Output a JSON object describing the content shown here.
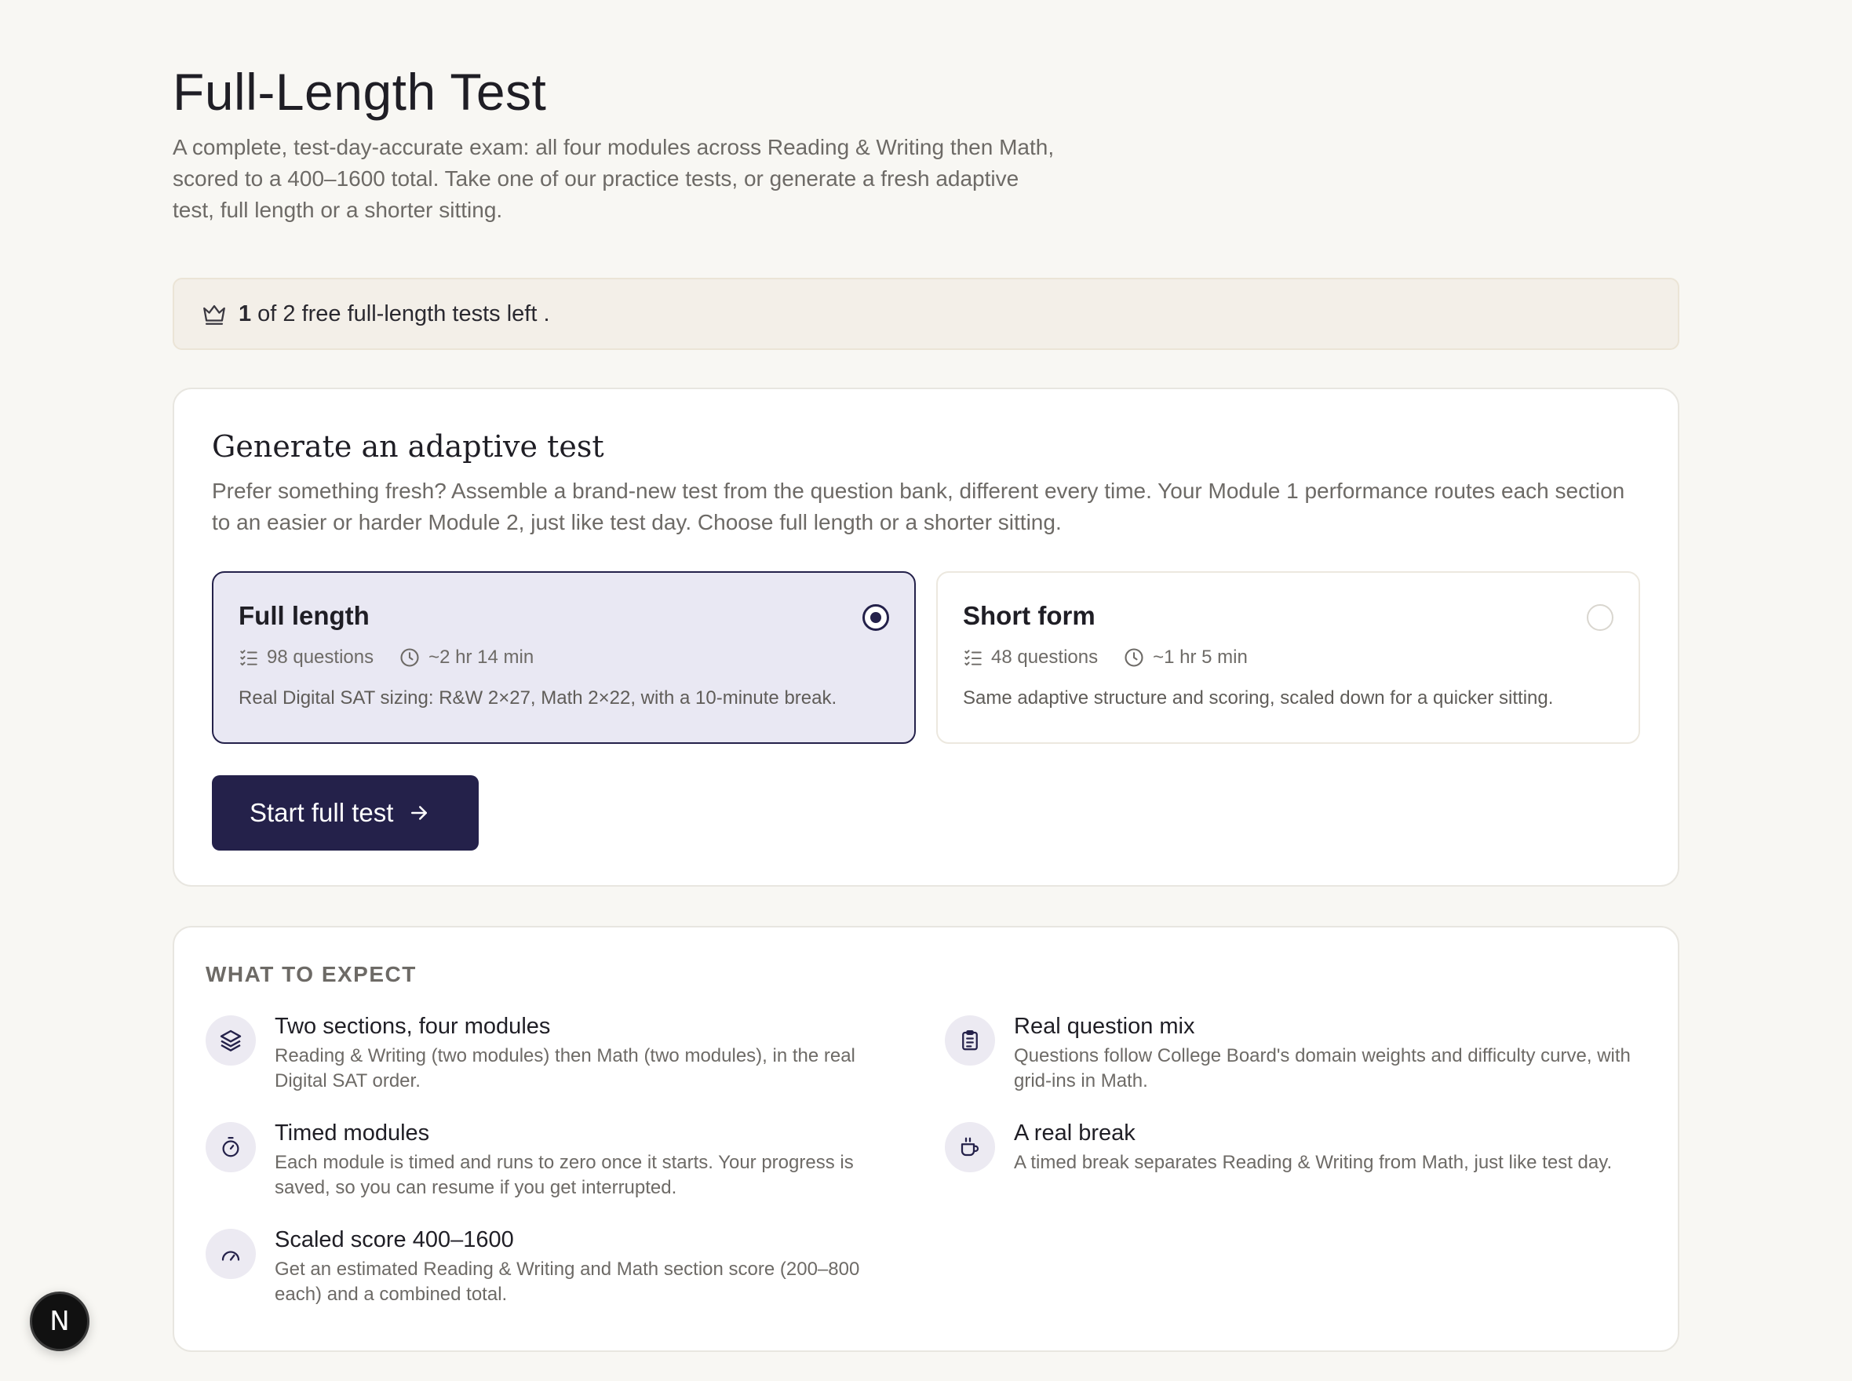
{
  "header": {
    "title": "Full-Length Test",
    "description": "A complete, test-day-accurate exam: all four modules across Reading & Writing then Math, scored to a 400–1600 total. Take one of our practice tests, or generate a fresh adaptive test, full length or a shorter sitting."
  },
  "quota": {
    "icon": "crown-icon",
    "count": "1",
    "text": "of 2 free full-length tests left ."
  },
  "generate": {
    "title": "Generate an adaptive test",
    "description": "Prefer something fresh? Assemble a brand-new test from the question bank, different every time. Your Module 1 performance routes each section to an easier or harder Module 2, just like test day. Choose full length or a shorter sitting.",
    "options": [
      {
        "title": "Full length",
        "questions": "98 questions",
        "duration": "~2 hr 14 min",
        "description": "Real Digital SAT sizing: R&W 2×27, Math 2×22, with a 10-minute break.",
        "selected": true
      },
      {
        "title": "Short form",
        "questions": "48 questions",
        "duration": "~1 hr 5 min",
        "description": "Same adaptive structure and scoring, scaled down for a quicker sitting.",
        "selected": false
      }
    ],
    "start_label": "Start full test"
  },
  "expect": {
    "heading": "WHAT TO EXPECT",
    "items": [
      {
        "icon": "layers-icon",
        "title": "Two sections, four modules",
        "description": "Reading & Writing (two modules) then Math (two modules), in the real Digital SAT order."
      },
      {
        "icon": "clipboard-icon",
        "title": "Real question mix",
        "description": "Questions follow College Board's domain weights and difficulty curve, with grid-ins in Math."
      },
      {
        "icon": "stopwatch-icon",
        "title": "Timed modules",
        "description": "Each module is timed and runs to zero once it starts. Your progress is saved, so you can resume if you get interrupted."
      },
      {
        "icon": "coffee-cup-icon",
        "title": "A real break",
        "description": "A timed break separates Reading & Writing from Math, just like test day."
      },
      {
        "icon": "gauge-icon",
        "title": "Scaled score 400–1600",
        "description": "Get an estimated Reading & Writing and Math section score (200–800 each) and a combined total."
      }
    ]
  },
  "fab": {
    "label": "N"
  },
  "colors": {
    "background": "#f8f7f3",
    "accent": "#24214a",
    "selected_bg": "#e9e8f3",
    "quota_bg": "#f3efe8"
  }
}
